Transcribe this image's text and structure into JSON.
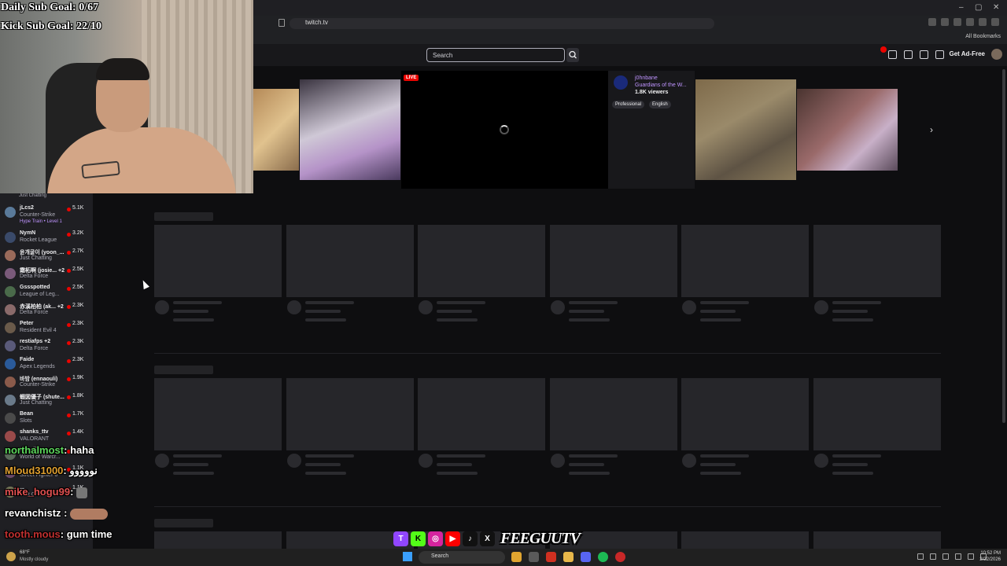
{
  "browser": {
    "url": "twitch.tv",
    "bookmarks_label": "All Bookmarks",
    "window_controls": [
      "–",
      "▢",
      "✕"
    ]
  },
  "topnav": {
    "search_placeholder": "Search",
    "adfree_label": "Get Ad-Free",
    "notification_count": "1"
  },
  "overlay": {
    "daily_goal": "Daily Sub Goal: 0/67",
    "kick_goal": "Kick Sub Goal: 22/10"
  },
  "sidebar": {
    "top_cut_label": "Just Chatting",
    "channels": [
      {
        "name": "jLcs2",
        "game": "Counter-Strike",
        "viewers": "5.1K",
        "hype": "Hype Train • Level 1"
      },
      {
        "name": "NymN",
        "game": "Rocket League",
        "viewers": "3.2K"
      },
      {
        "name": "윤개굴이 (yoon_...",
        "game": "Just Chatting",
        "viewers": "2.7K"
      },
      {
        "name": "霜柘啊 (josie... +2",
        "game": "Delta Force",
        "viewers": "2.5K"
      },
      {
        "name": "Gssspotted",
        "game": "League of Leg...",
        "viewers": "2.5K"
      },
      {
        "name": "赤溪柏柏 (ak... +2",
        "game": "Delta Force",
        "viewers": "2.3K"
      },
      {
        "name": "Peter",
        "game": "Resident Evil 4",
        "viewers": "2.3K"
      },
      {
        "name": "restiafps +2",
        "game": "Delta Force",
        "viewers": "2.3K"
      },
      {
        "name": "Faide",
        "game": "Apex Legends",
        "viewers": "2.3K"
      },
      {
        "name": "바밤 (ennaouli)",
        "game": "Counter-Strike",
        "viewers": "1.9K"
      },
      {
        "name": "蝦図優子 (shute...",
        "game": "Just Chatting",
        "viewers": "1.8K"
      },
      {
        "name": "Bean",
        "game": "Slots",
        "viewers": "1.7K"
      },
      {
        "name": "shanks_ttv",
        "game": "VALORANT",
        "viewers": "1.4K"
      },
      {
        "name": "Towelliee",
        "game": "World of Warcr...",
        "viewers": "1.1K"
      },
      {
        "name": "...",
        "game": "Street Fighter 6",
        "viewers": "1.1K"
      },
      {
        "name": "...",
        "game": "Just Chatting",
        "viewers": "1.1K"
      }
    ]
  },
  "featured": {
    "live_label": "LIVE",
    "streamer": "j0hnbane",
    "game": "Guardians of the W...",
    "viewers": "1.8K viewers",
    "tags": [
      "Professional",
      "English"
    ],
    "next_arrow": "›"
  },
  "chat": [
    {
      "user": "northalmost",
      "sep": ": ",
      "msg": "haha",
      "color": "#5cd65c"
    },
    {
      "user": "Mloud31000",
      "sep": ": ",
      "msg": "نووووو",
      "color": "#e0a030"
    },
    {
      "user": "mike_hogu99",
      "sep": ": ",
      "msg": "",
      "color": "#e05050"
    },
    {
      "user": "revanchistz",
      "sep": " : ",
      "msg": "",
      "color": "#ffffff"
    },
    {
      "user": "tooth.mous",
      "sep": ": ",
      "msg": "gum time",
      "color": "#c03030"
    }
  ],
  "socials": {
    "brand": "FEEGUUTV",
    "icons": [
      {
        "name": "twitch-icon",
        "glyph": "T",
        "color": "#9146ff"
      },
      {
        "name": "kick-icon",
        "glyph": "K",
        "color": "#53fc18"
      },
      {
        "name": "instagram-icon",
        "glyph": "◎",
        "color": "#d6249f"
      },
      {
        "name": "youtube-icon",
        "glyph": "▶",
        "color": "#ff0000"
      },
      {
        "name": "tiktok-icon",
        "glyph": "♪",
        "color": "#111111"
      },
      {
        "name": "x-icon",
        "glyph": "X",
        "color": "#111111"
      }
    ]
  },
  "taskbar": {
    "temperature": "68°F",
    "weather": "Mostly cloudy",
    "search": "Search",
    "time": "10:52 PM",
    "date": "2/22/2026"
  }
}
